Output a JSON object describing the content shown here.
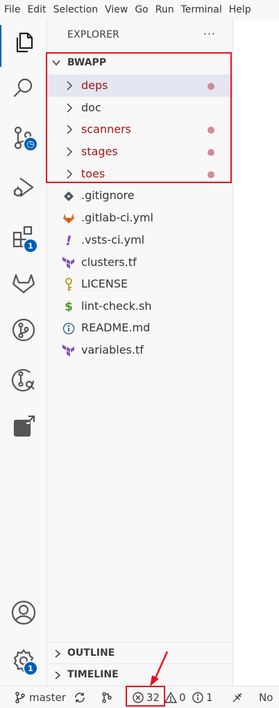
{
  "menu": [
    "File",
    "Edit",
    "Selection",
    "View",
    "Go",
    "Run",
    "Terminal",
    "Help"
  ],
  "activity_bar": {
    "items": [
      {
        "icon": "files-icon",
        "active": true
      },
      {
        "icon": "search-icon"
      },
      {
        "icon": "source-control-icon"
      },
      {
        "icon": "run-debug-icon"
      },
      {
        "icon": "extensions-icon",
        "badge": "1"
      },
      {
        "icon": "gitlab-icon"
      },
      {
        "icon": "git-branch-icon"
      },
      {
        "icon": "git-branch-search-icon"
      },
      {
        "icon": "remote-explorer-icon"
      }
    ],
    "bottom": [
      {
        "icon": "account-icon"
      },
      {
        "icon": "settings-gear-icon",
        "badge": "1"
      }
    ]
  },
  "explorer": {
    "title": "EXPLORER",
    "more": "···",
    "root": "BWAPP",
    "folders": [
      {
        "name": "deps",
        "modified": true,
        "selected": true
      },
      {
        "name": "doc",
        "modified": false
      },
      {
        "name": "scanners",
        "modified": true
      },
      {
        "name": "stages",
        "modified": true
      },
      {
        "name": "toes",
        "modified": true
      }
    ],
    "files": [
      {
        "name": ".gitignore",
        "icon": "git-diamond-icon"
      },
      {
        "name": ".gitlab-ci.yml",
        "icon": "gitlab-fox-icon"
      },
      {
        "name": ".vsts-ci.yml",
        "icon": "exclamation-icon"
      },
      {
        "name": "clusters.tf",
        "icon": "terraform-icon"
      },
      {
        "name": "LICENSE",
        "icon": "key-icon"
      },
      {
        "name": "lint-check.sh",
        "icon": "dollar-icon"
      },
      {
        "name": "README.md",
        "icon": "info-icon"
      },
      {
        "name": "variables.tf",
        "icon": "terraform-icon"
      }
    ],
    "panels": [
      "OUTLINE",
      "TIMELINE"
    ]
  },
  "status_bar": {
    "branch": "master",
    "errors": "32",
    "warnings": "0",
    "info": "1",
    "right_text": "No"
  },
  "colors": {
    "modified": "#a31515",
    "highlight": "#e8101f",
    "accent": "#005fb8"
  }
}
